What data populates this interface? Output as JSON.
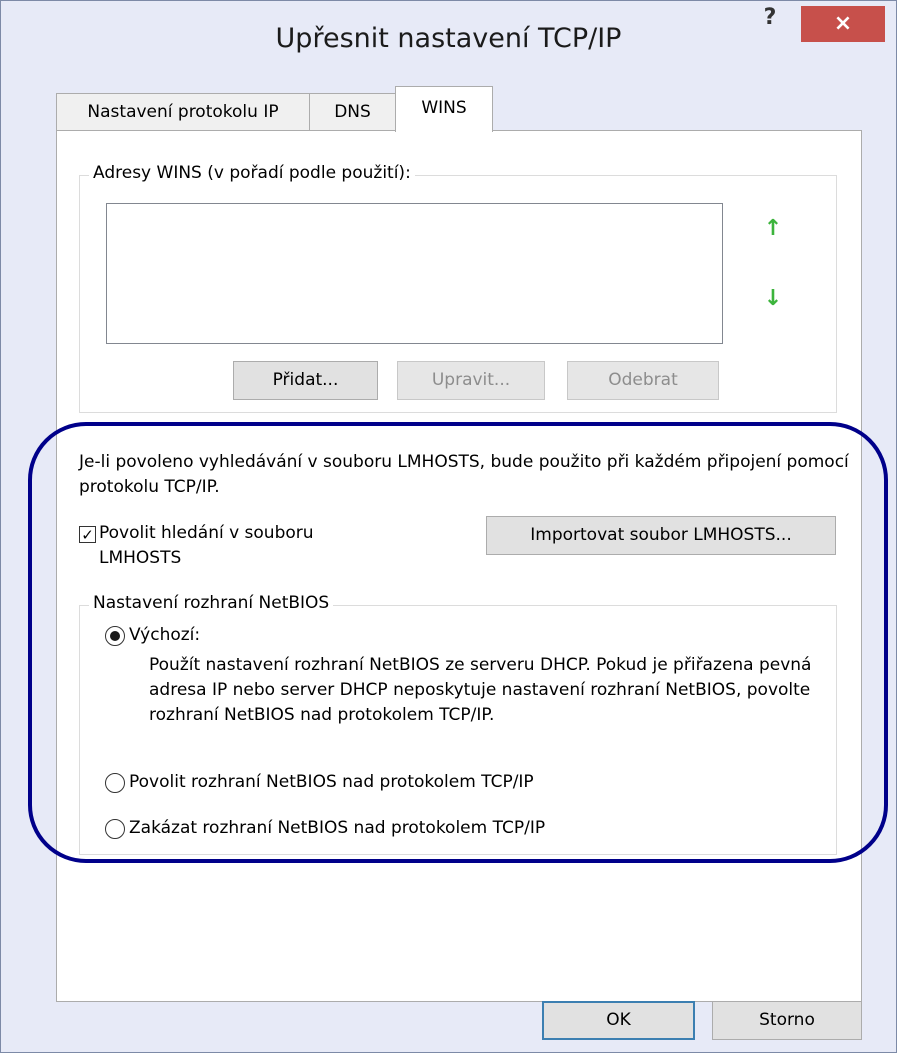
{
  "window": {
    "title": "Upřesnit nastavení TCP/IP",
    "help_label": "?",
    "close_label": "×"
  },
  "tabs": [
    {
      "label": "Nastavení protokolu IP"
    },
    {
      "label": "DNS"
    },
    {
      "label": "WINS"
    }
  ],
  "wins": {
    "group_label": "Adresy WINS (v pořadí podle použití):",
    "move_up_icon": "↑",
    "move_down_icon": "↓",
    "add_label": "Přidat...",
    "edit_label": "Upravit...",
    "remove_label": "Odebrat"
  },
  "lmhosts": {
    "description": "Je-li povoleno vyhledávání v souboru LMHOSTS, bude použito při každém připojení pomocí protokolu TCP/IP.",
    "checkbox_label": "Povolit hledání v souboru LMHOSTS",
    "checkbox_checked": true,
    "checkmark": "✓",
    "import_label": "Importovat soubor LMHOSTS..."
  },
  "netbios": {
    "group_label": "Nastavení rozhraní NetBIOS",
    "options": [
      {
        "label": "Výchozí:",
        "selected": true
      },
      {
        "label": "Povolit rozhraní NetBIOS nad protokolem TCP/IP",
        "selected": false
      },
      {
        "label": "Zakázat rozhraní NetBIOS nad protokolem TCP/IP",
        "selected": false
      }
    ],
    "default_description": "Použít nastavení rozhraní NetBIOS ze serveru DHCP. Pokud je přiřazena pevná adresa IP nebo server DHCP neposkytuje nastavení rozhraní NetBIOS, povolte rozhraní NetBIOS nad protokolem TCP/IP."
  },
  "footer": {
    "ok_label": "OK",
    "cancel_label": "Storno"
  },
  "colors": {
    "highlight_border": "#00008a",
    "close_button": "#c7504b",
    "arrow_green": "#3cb43c"
  }
}
